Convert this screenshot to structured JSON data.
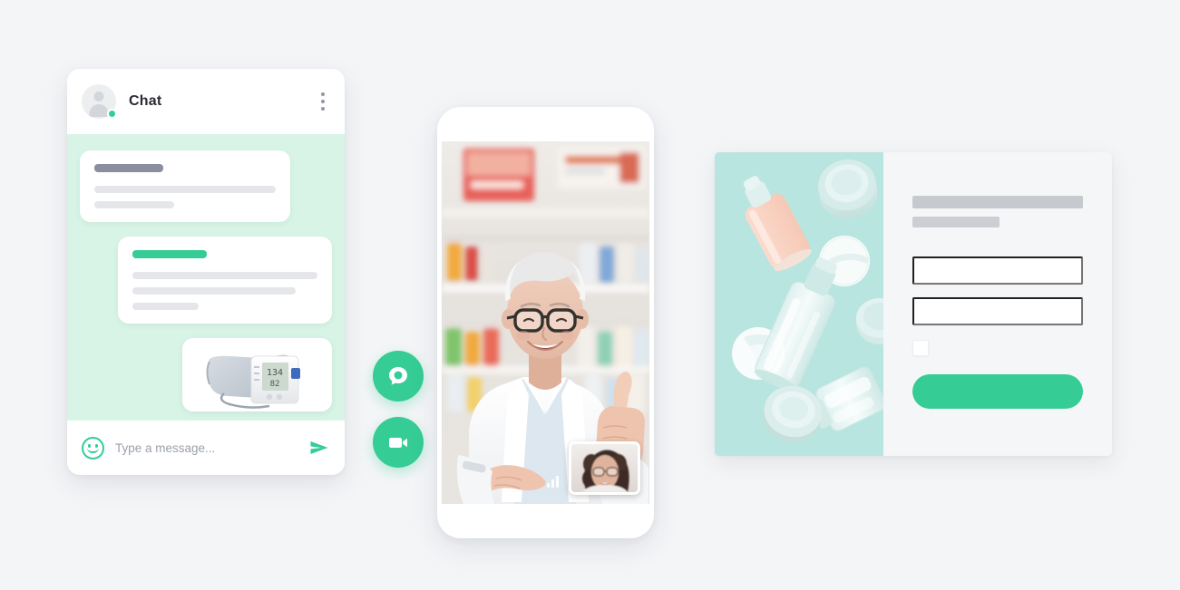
{
  "theme": {
    "page_background": "#f4f5f7",
    "accent_green": "#35cc96",
    "chat_background": "#d7f4e6",
    "card_background": "#f5f6f8",
    "product_panel_background": "#b9e5e0",
    "placeholder_gray": "#e4e6e9",
    "placeholder_dark": "#8a8fa0"
  },
  "chat": {
    "title": "Chat",
    "avatar_icon": "user-avatar-icon",
    "status": "online",
    "menu_icon": "more-vertical-icon",
    "messages": [
      {
        "id": "message-incoming-1",
        "direction": "incoming",
        "title_placeholder": true,
        "title_color": "#8a8fa0",
        "line_widths": [
          "100%",
          "44%"
        ]
      },
      {
        "id": "message-outgoing-1",
        "direction": "outgoing",
        "title_placeholder": true,
        "title_color": "#35cc96",
        "title_width": "40%",
        "line_widths": [
          "100%",
          "88%",
          "36%"
        ]
      },
      {
        "id": "message-outgoing-image",
        "direction": "outgoing",
        "type": "image",
        "image_alt": "blood-pressure-monitor"
      }
    ],
    "composer": {
      "emoji_icon": "smiley-face-icon",
      "placeholder": "Type a message...",
      "value": "",
      "send_icon": "send-arrow-icon"
    }
  },
  "floating_actions": [
    {
      "id": "fab-chat",
      "icon": "chat-bubble-icon",
      "color": "#35cc96"
    },
    {
      "id": "fab-video",
      "icon": "video-camera-icon",
      "color": "#35cc96"
    }
  ],
  "phone": {
    "call": {
      "main_video_alt": "pharmacist-smiling-thumbs-up",
      "pip_video_alt": "patient-curly-hair-glasses",
      "signal_icon": "signal-bars-icon"
    }
  },
  "product_card": {
    "image_alt": "cosmetic-bottles-on-mint-background",
    "form": {
      "title_placeholder": true,
      "subtitle_placeholder": true,
      "fields": [
        {
          "id": "form-input-1",
          "value": "",
          "placeholder": ""
        },
        {
          "id": "form-input-2",
          "value": "",
          "placeholder": ""
        }
      ],
      "checkbox": {
        "id": "form-checkbox",
        "checked": false
      },
      "submit": {
        "id": "form-submit-button",
        "label": "",
        "color": "#35cc96"
      }
    }
  }
}
